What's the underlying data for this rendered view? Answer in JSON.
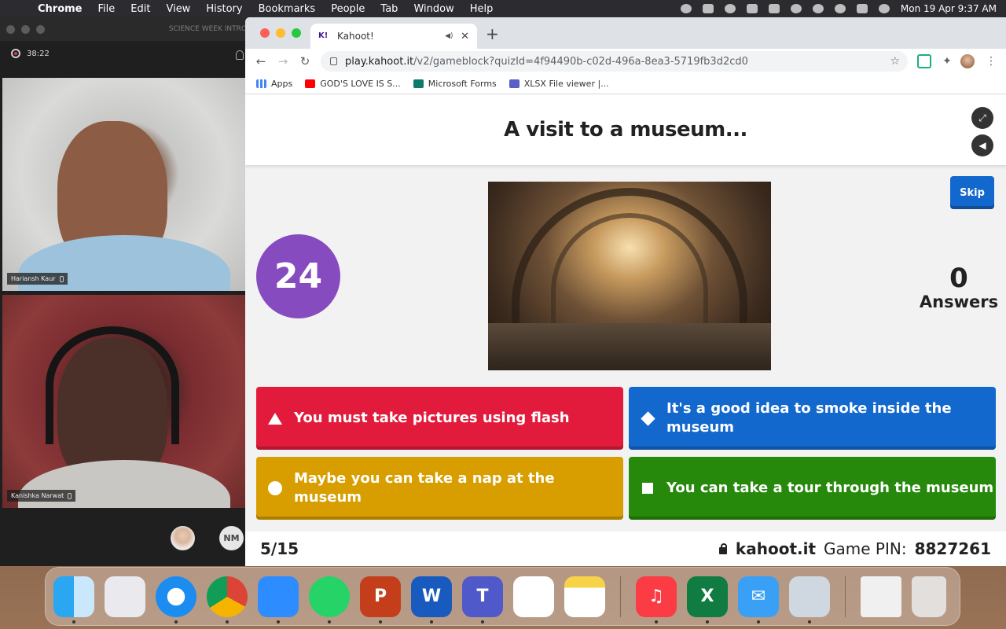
{
  "menubar": {
    "app": "Chrome",
    "items": [
      "File",
      "Edit",
      "View",
      "History",
      "Bookmarks",
      "People",
      "Tab",
      "Window",
      "Help"
    ],
    "datetime": "Mon 19 Apr  9:37 AM"
  },
  "meeting": {
    "title": "SCIENCE WEEK INTRO",
    "recording_time": "38:22",
    "participants": [
      {
        "name": "Hariansh Kaur"
      },
      {
        "name": "Kanishka Narwat"
      }
    ],
    "avatar_initials": "NM"
  },
  "browser": {
    "tab_title": "Kahoot!",
    "tab_favicon": "K!",
    "url_host": "play.kahoot.it",
    "url_path": "/v2/gameblock?quizId=4f94490b-c02d-496a-8ea3-5719fb3d2cd0",
    "bookmarks": [
      "Apps",
      "GOD'S LOVE IS S...",
      "Microsoft Forms",
      "XLSX File viewer |..."
    ]
  },
  "kahoot": {
    "question": "A visit to a museum...",
    "skip_label": "Skip",
    "timer": "24",
    "answers_count": "0",
    "answers_label": "Answers",
    "options": [
      {
        "text": "You must take pictures using flash",
        "color": "#e21b3c",
        "shape": "triangle-icon"
      },
      {
        "text": "It's a good idea to smoke inside the museum",
        "color": "#1368ce",
        "shape": "diamond-icon"
      },
      {
        "text": "Maybe you can take a nap at the museum",
        "color": "#d89e00",
        "shape": "circle-icon"
      },
      {
        "text": "You can take a tour through the museum",
        "color": "#26890c",
        "shape": "square-icon"
      }
    ],
    "progress": "5/15",
    "site": "kahoot.it",
    "pin_label": "Game PIN:",
    "pin": "8827261"
  },
  "dock": {
    "apps": [
      "Finder",
      "Launchpad",
      "Safari",
      "Chrome",
      "Zoom",
      "WhatsApp",
      "PowerPoint",
      "Word",
      "Teams",
      "Reminders",
      "Notes",
      "Music",
      "Excel",
      "Mail",
      "Preview",
      "Document",
      "Trash"
    ]
  }
}
